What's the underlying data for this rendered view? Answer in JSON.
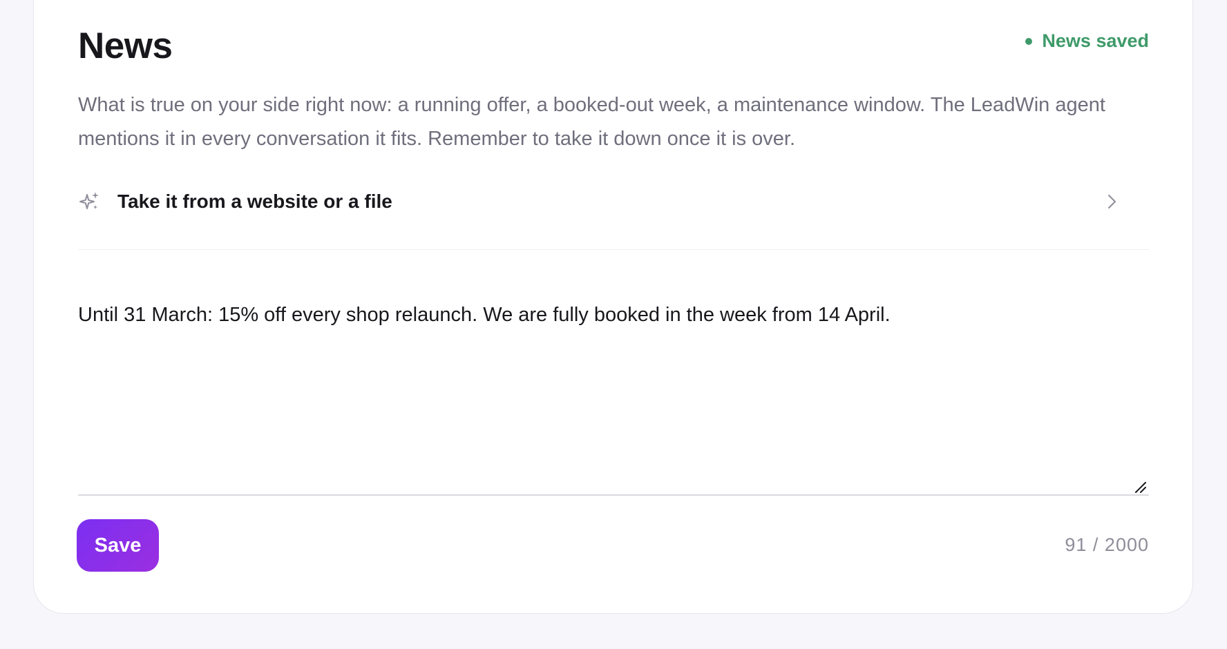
{
  "header": {
    "title": "News",
    "status": "News saved"
  },
  "description": "What is true on your side right now: a running offer, a booked-out week, a maintenance window. The LeadWin agent mentions it in every conversation it fits. Remember to take it down once it is over.",
  "import": {
    "label": "Take it from a website or a file",
    "icon": "sparkle-icon"
  },
  "editor": {
    "value": "Until 31 March: 15% off every shop relaunch. We are fully booked in the week from 14 April.",
    "char_count": "91 / 2000"
  },
  "actions": {
    "save_label": "Save"
  },
  "colors": {
    "accent": "#7b2ff2",
    "status": "#3e9a69"
  }
}
